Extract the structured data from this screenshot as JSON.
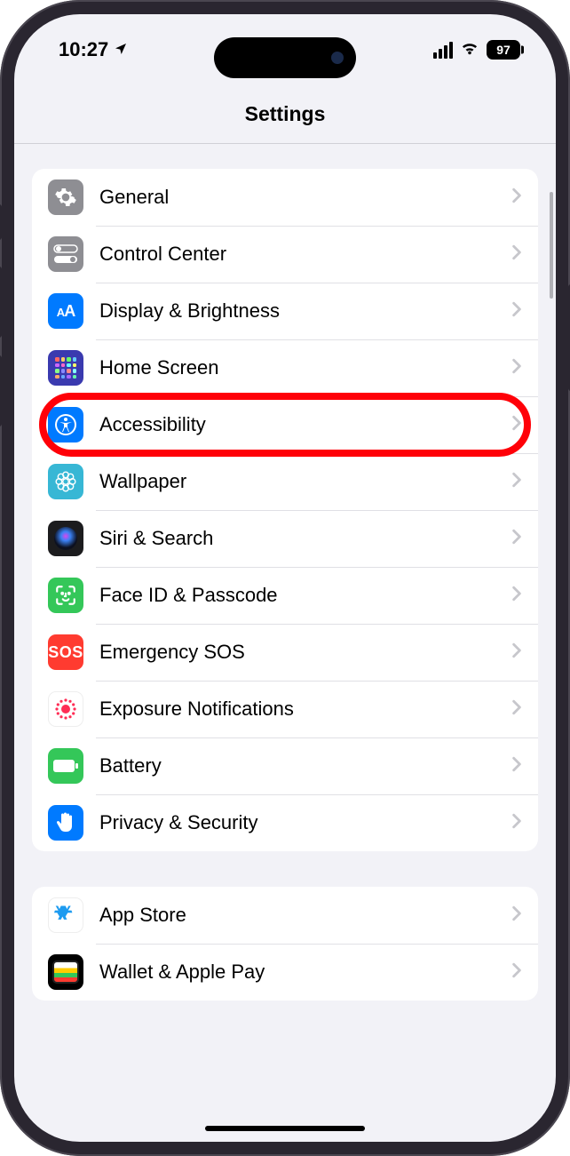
{
  "status": {
    "time": "10:27",
    "battery_level": "97"
  },
  "nav": {
    "title": "Settings"
  },
  "group1": {
    "items": [
      {
        "label": "General",
        "icon": "gear-icon",
        "iconClass": "ic-general",
        "highlighted": false
      },
      {
        "label": "Control Center",
        "icon": "switches-icon",
        "iconClass": "ic-cc",
        "highlighted": false
      },
      {
        "label": "Display & Brightness",
        "icon": "aa-icon",
        "iconClass": "ic-display",
        "highlighted": false
      },
      {
        "label": "Home Screen",
        "icon": "app-grid-icon",
        "iconClass": "ic-home",
        "highlighted": false
      },
      {
        "label": "Accessibility",
        "icon": "accessibility-icon",
        "iconClass": "ic-access",
        "highlighted": true
      },
      {
        "label": "Wallpaper",
        "icon": "flower-icon",
        "iconClass": "ic-wallpaper",
        "highlighted": false
      },
      {
        "label": "Siri & Search",
        "icon": "siri-icon",
        "iconClass": "ic-siri",
        "highlighted": false
      },
      {
        "label": "Face ID & Passcode",
        "icon": "faceid-icon",
        "iconClass": "ic-faceid",
        "highlighted": false
      },
      {
        "label": "Emergency SOS",
        "icon": "sos-icon",
        "iconClass": "ic-sos",
        "highlighted": false
      },
      {
        "label": "Exposure Notifications",
        "icon": "exposure-icon",
        "iconClass": "ic-expose",
        "highlighted": false
      },
      {
        "label": "Battery",
        "icon": "battery-icon",
        "iconClass": "ic-battery",
        "highlighted": false
      },
      {
        "label": "Privacy & Security",
        "icon": "hand-icon",
        "iconClass": "ic-privacy",
        "highlighted": false
      }
    ]
  },
  "group2": {
    "items": [
      {
        "label": "App Store",
        "icon": "appstore-icon",
        "iconClass": "ic-appstore"
      },
      {
        "label": "Wallet & Apple Pay",
        "icon": "wallet-icon",
        "iconClass": "ic-wallet"
      }
    ]
  }
}
